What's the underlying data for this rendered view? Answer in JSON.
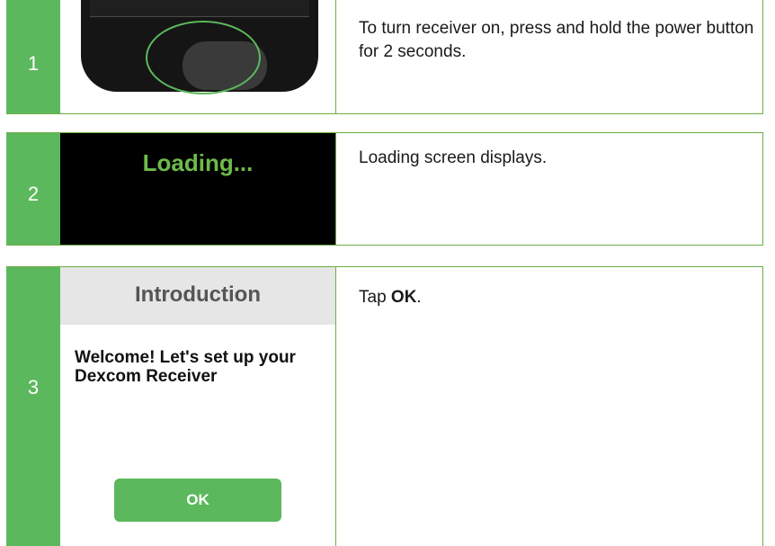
{
  "steps": [
    {
      "number": "1",
      "text": "To turn receiver on, press and hold the power button for 2 seconds."
    },
    {
      "number": "2",
      "screen_text": "Loading...",
      "text": "Loading screen displays."
    },
    {
      "number": "3",
      "screen_title": "Introduction",
      "screen_message": "Welcome! Let's set up your Dexcom Receiver",
      "screen_button": "OK",
      "text_prefix": "Tap ",
      "text_bold": "OK",
      "text_suffix": "."
    }
  ],
  "colors": {
    "accent_green": "#5cb85c",
    "loading_text_green": "#6dbb4a",
    "border_green": "#6dac45"
  }
}
